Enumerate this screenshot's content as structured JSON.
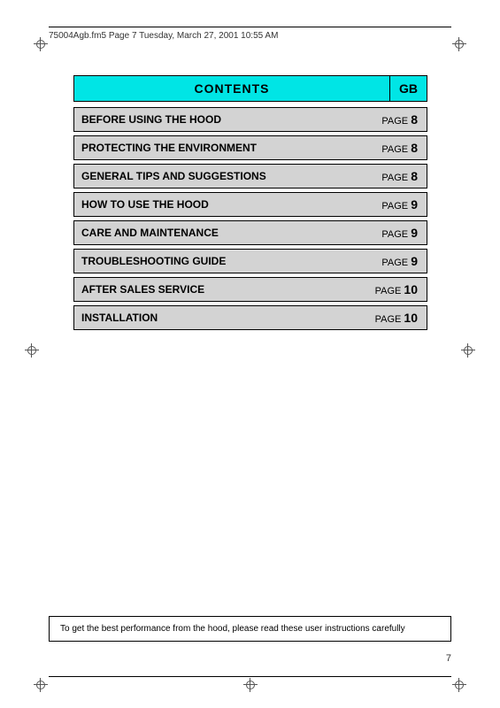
{
  "header": {
    "file_info": "75004Agb.fm5  Page 7  Tuesday, March 27, 2001  10:55 AM"
  },
  "contents": {
    "title": "CONTENTS",
    "gb_label": "GB",
    "rows": [
      {
        "title": "BEFORE USING THE HOOD",
        "page_label": "PAGE",
        "page_num": "8"
      },
      {
        "title": "PROTECTING THE ENVIRONMENT",
        "page_label": "PAGE",
        "page_num": "8"
      },
      {
        "title": "GENERAL TIPS AND SUGGESTIONS",
        "page_label": "PAGE",
        "page_num": "8"
      },
      {
        "title": "HOW TO USE THE HOOD",
        "page_label": "PAGE",
        "page_num": "9"
      },
      {
        "title": "CARE AND MAINTENANCE",
        "page_label": "PAGE",
        "page_num": "9"
      },
      {
        "title": "TROUBLESHOOTING GUIDE",
        "page_label": "PAGE",
        "page_num": "9"
      },
      {
        "title": "AFTER SALES SERVICE",
        "page_label": "PAGE",
        "page_num": "10"
      },
      {
        "title": "INSTALLATION",
        "page_label": "PAGE",
        "page_num": "10"
      }
    ]
  },
  "footer": {
    "note": "To get the best performance from the hood, please read these user instructions carefully"
  },
  "page_number": "7"
}
